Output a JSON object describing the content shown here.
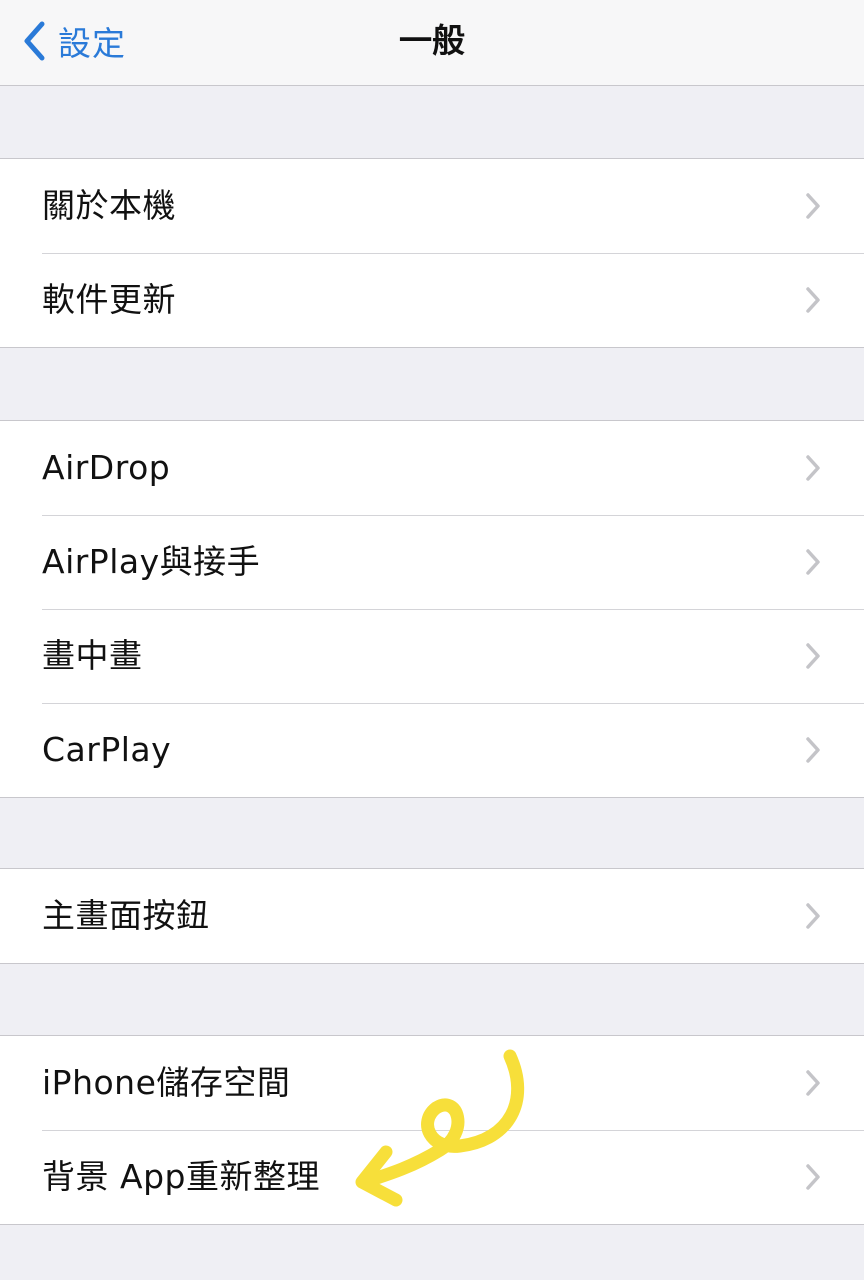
{
  "navbar": {
    "back_label": "設定",
    "title": "一般"
  },
  "groups": [
    {
      "items": [
        {
          "label": "關於本機"
        },
        {
          "label": "軟件更新"
        }
      ]
    },
    {
      "items": [
        {
          "label": "AirDrop"
        },
        {
          "label": "AirPlay與接手"
        },
        {
          "label": "畫中畫"
        },
        {
          "label": "CarPlay"
        }
      ]
    },
    {
      "items": [
        {
          "label": "主畫面按鈕"
        }
      ]
    },
    {
      "items": [
        {
          "label": "iPhone儲存空間"
        },
        {
          "label": "背景 App重新整理"
        }
      ]
    }
  ],
  "colors": {
    "accent": "#2a7ad8",
    "background": "#efeff4",
    "annotation": "#f7df3a"
  },
  "icons": {
    "back": "chevron-left-icon",
    "row": "chevron-right-icon"
  }
}
